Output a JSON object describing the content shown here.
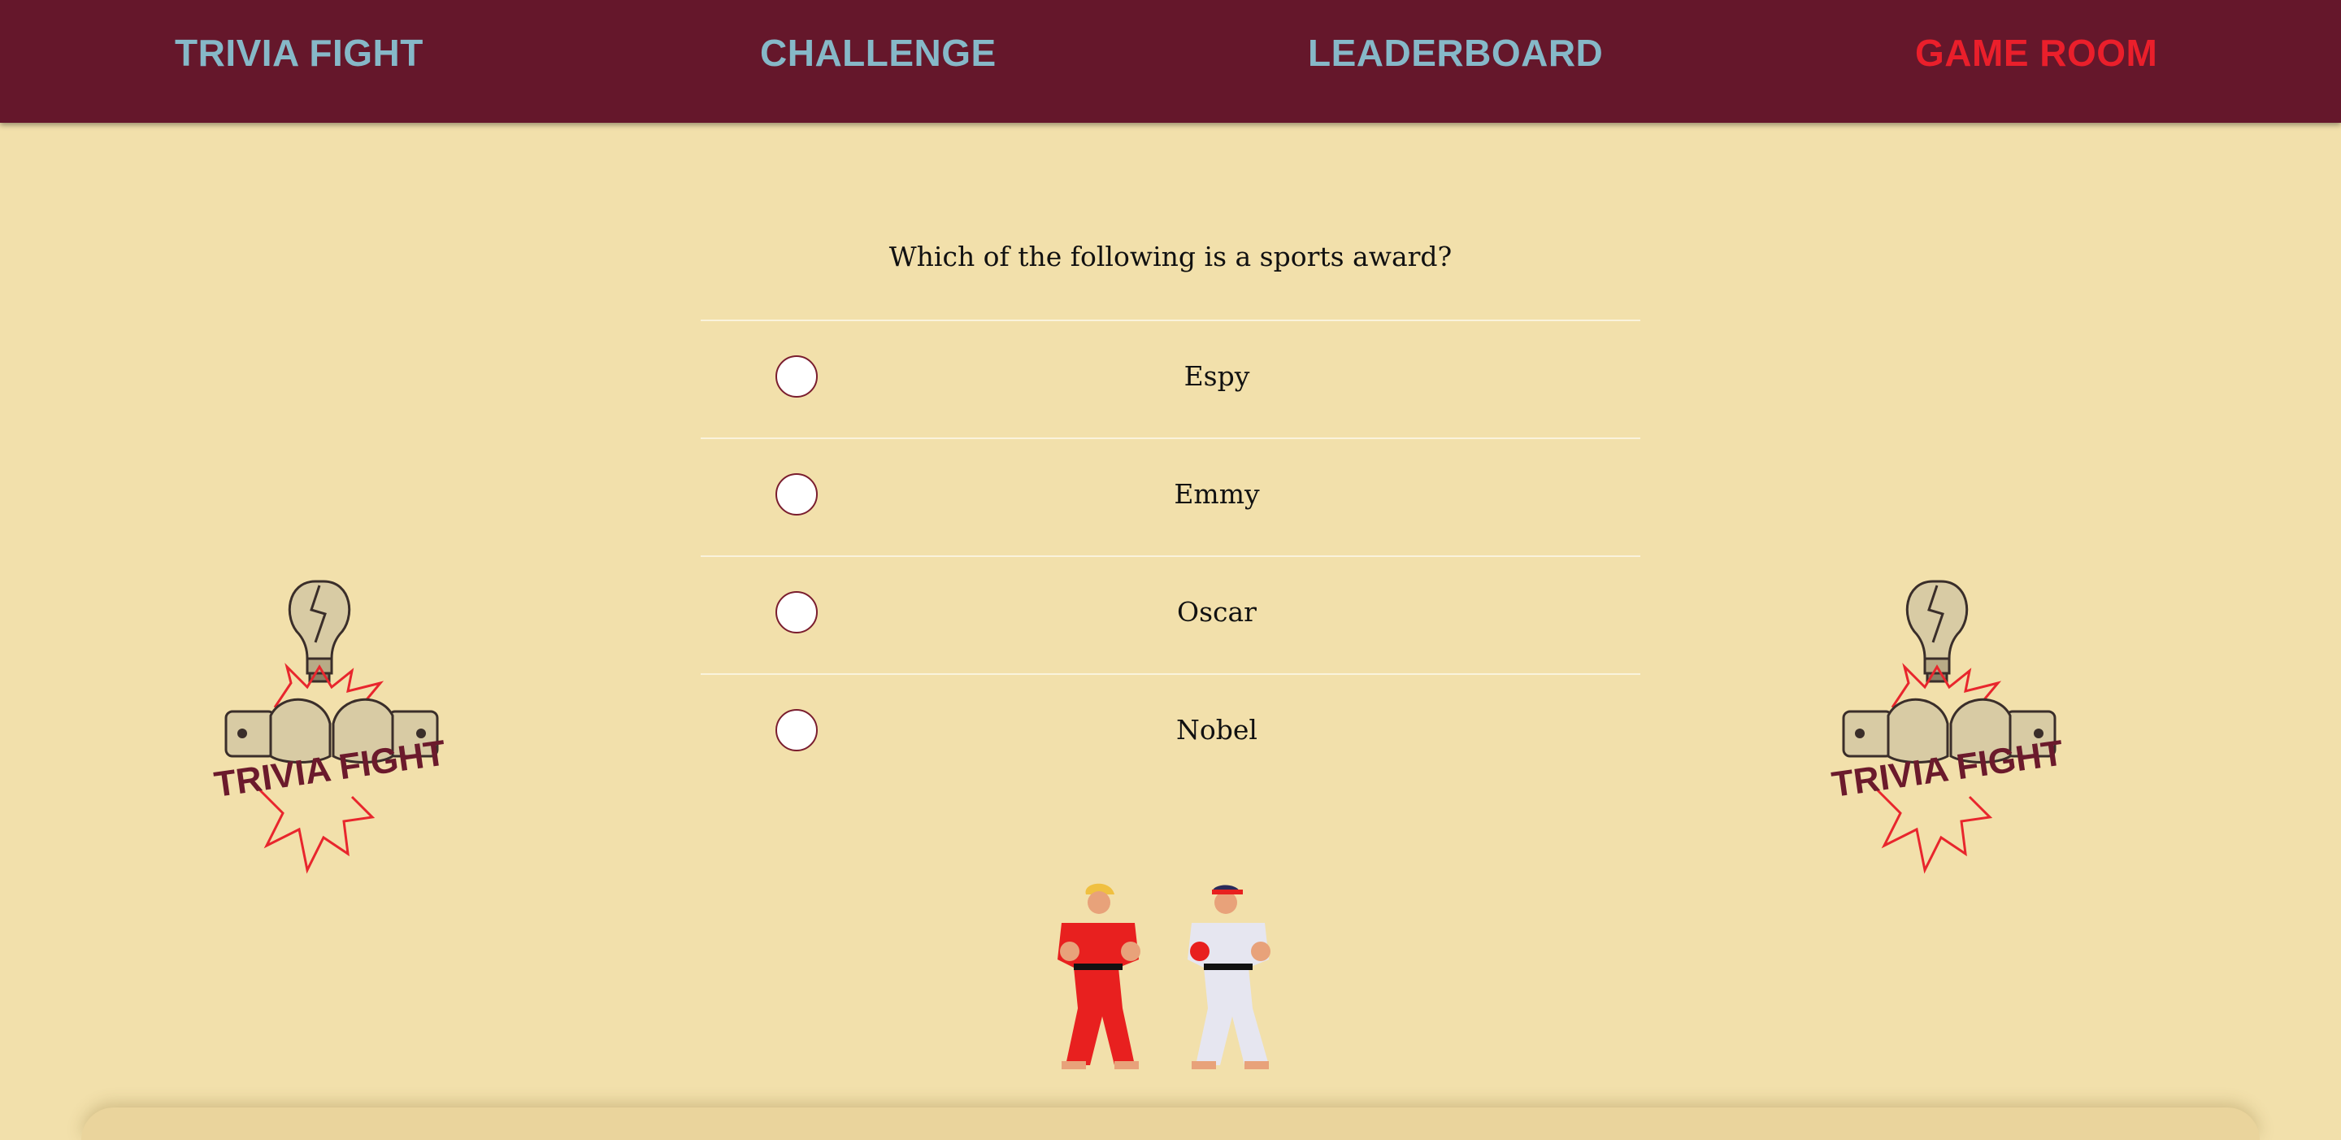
{
  "nav": {
    "brand": "TRIVIA FIGHT",
    "challenge": "CHALLENGE",
    "leaderboard": "LEADERBOARD",
    "game_room": "GAME ROOM"
  },
  "quiz": {
    "question": "Which of the following is a sports award?",
    "choices": [
      {
        "label": "Espy",
        "selected": false
      },
      {
        "label": "Emmy",
        "selected": false
      },
      {
        "label": "Oscar",
        "selected": false
      },
      {
        "label": "Nobel",
        "selected": false
      }
    ]
  },
  "logo": {
    "text": "TRIVIA FIGHT"
  },
  "colors": {
    "background": "#f2e0ab",
    "navbar": "#65172b",
    "nav_link": "#86b8c8",
    "nav_active": "#ea1f2b",
    "logo_text": "#6b1a2c",
    "burst": "#e8262d"
  },
  "icons": {
    "logo": "lightbulb-fists-logo-icon",
    "fighters": "street-fighter-sprites-icon"
  }
}
